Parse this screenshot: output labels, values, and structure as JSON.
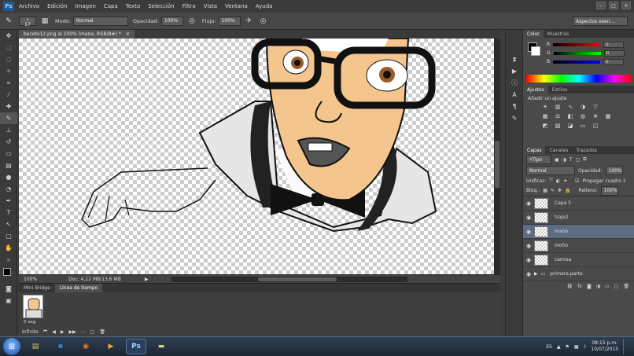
{
  "app": {
    "logo": "Ps"
  },
  "menu": [
    "Archivo",
    "Edición",
    "Imagen",
    "Capa",
    "Texto",
    "Selección",
    "Filtro",
    "Vista",
    "Ventana",
    "Ayuda"
  ],
  "options": {
    "brush_size": "17",
    "mode_label": "Modo:",
    "mode_value": "Normal",
    "opacity_label": "Opacidad:",
    "opacity_value": "100%",
    "flow_label": "Flujo:",
    "flow_value": "100%",
    "workspace": "Aspectos esen..."
  },
  "document": {
    "tab_title": "boceto12.png al 100% (mano, RGB/8#) *",
    "zoom": "100%",
    "doc_size": "Doc: 4,12 MB/13,6 MB"
  },
  "bottom_panel": {
    "tabs": [
      "Mini Bridge",
      "Línea de tiempo"
    ],
    "frame_label": "0 seg.",
    "loop": "Infinito"
  },
  "color_panel": {
    "tabs": [
      "Color",
      "Muestras"
    ],
    "channels": [
      {
        "label": "R",
        "value": "0",
        "color": "#e03030"
      },
      {
        "label": "G",
        "value": "0",
        "color": "#30c030"
      },
      {
        "label": "B",
        "value": "0",
        "color": "#3060e0"
      }
    ]
  },
  "adjust_panel": {
    "tabs": [
      "Ajustes",
      "Estilos"
    ],
    "title": "Añadir un ajuste"
  },
  "layers_panel": {
    "tabs": [
      "Capas",
      "Canales",
      "Trazados"
    ],
    "filter": "Tipo",
    "blend": "Normal",
    "opacity_label": "Opacidad:",
    "opacity_value": "100%",
    "lock_label": "Bloq.:",
    "fill_label": "Relleno:",
    "fill_value": "100%",
    "unify_label": "Unificar:",
    "propagate_label": "Propagar cuadro 1",
    "layers": [
      {
        "name": "Capa 5",
        "selected": false
      },
      {
        "name": "traje2",
        "selected": false
      },
      {
        "name": "mano",
        "selected": true
      },
      {
        "name": "moño",
        "selected": false
      },
      {
        "name": "camisa",
        "selected": false
      },
      {
        "name": "primera parte",
        "selected": false,
        "group": true
      }
    ]
  },
  "taskbar": {
    "apps": [
      {
        "name": "explorer",
        "glyph": "▤",
        "color": "#e8c45a"
      },
      {
        "name": "ie",
        "glyph": "e",
        "color": "#3b9cf0"
      },
      {
        "name": "firefox",
        "glyph": "◉",
        "color": "#ef7a23"
      },
      {
        "name": "media",
        "glyph": "▶",
        "color": "#f0a830"
      },
      {
        "name": "photoshop",
        "glyph": "Ps",
        "color": "#9fd3ff"
      },
      {
        "name": "notes",
        "glyph": "▬",
        "color": "#c9d77a"
      }
    ],
    "lang": "ES",
    "time": "08:15 p.m.",
    "date": "10/07/2013"
  }
}
